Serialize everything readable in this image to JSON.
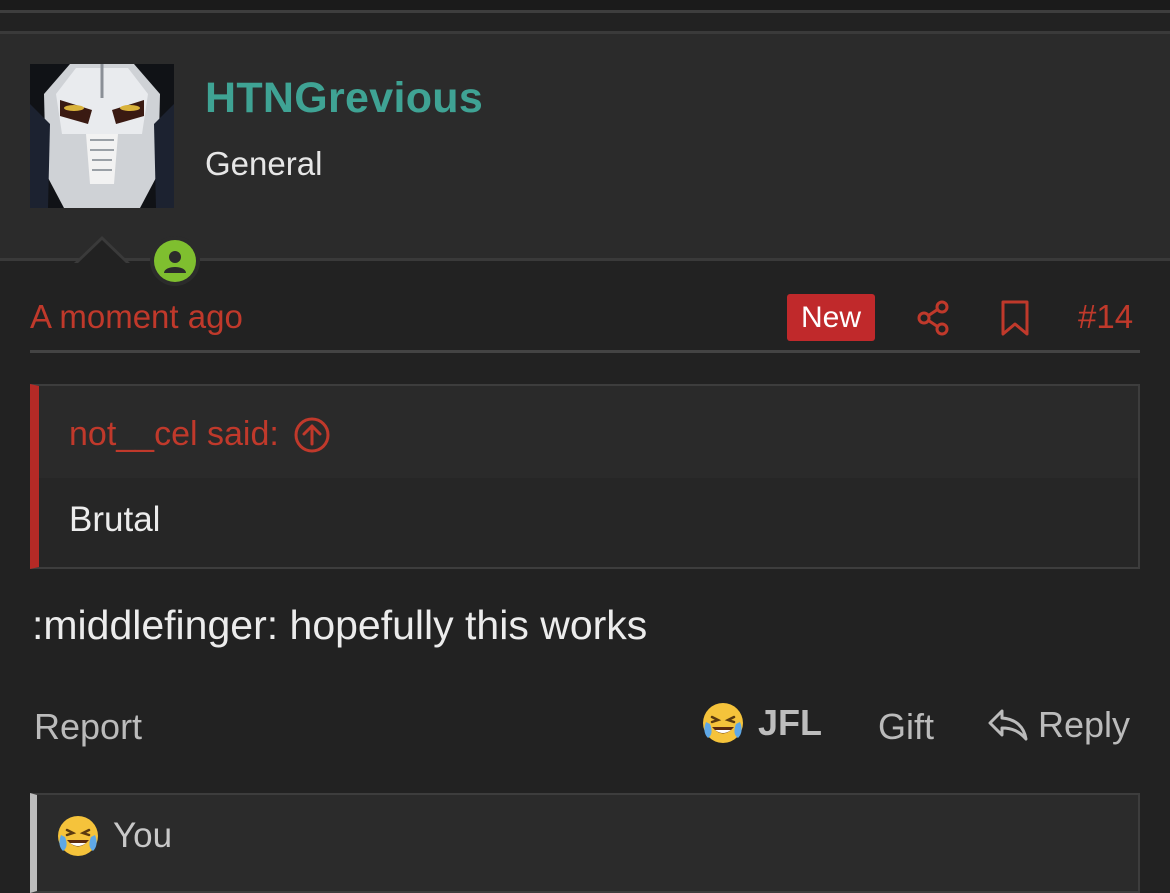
{
  "author": {
    "username": "HTNGrevious",
    "title": "General",
    "avatar_icon": "general-grievous-avatar",
    "online_status_icon": "user-online-icon",
    "username_color": "#3fa394"
  },
  "post": {
    "timestamp": "A moment ago",
    "badge": "New",
    "share_icon": "share-icon",
    "bookmark_icon": "bookmark-icon",
    "number": "#14",
    "accent_color": "#c0392b"
  },
  "quote": {
    "author_label": "not__cel said:",
    "jump_icon": "arrow-up-circle-icon",
    "text": "Brutal"
  },
  "message": ":middlefinger: hopefully this works",
  "actions": {
    "report": "Report",
    "reaction_label": "JFL",
    "reaction_icon": "laughing-crying-emoji",
    "gift": "Gift",
    "reply": "Reply",
    "reply_icon": "reply-arrow-icon"
  },
  "reactions_bar": {
    "icon": "laughing-crying-emoji",
    "label": "You"
  }
}
